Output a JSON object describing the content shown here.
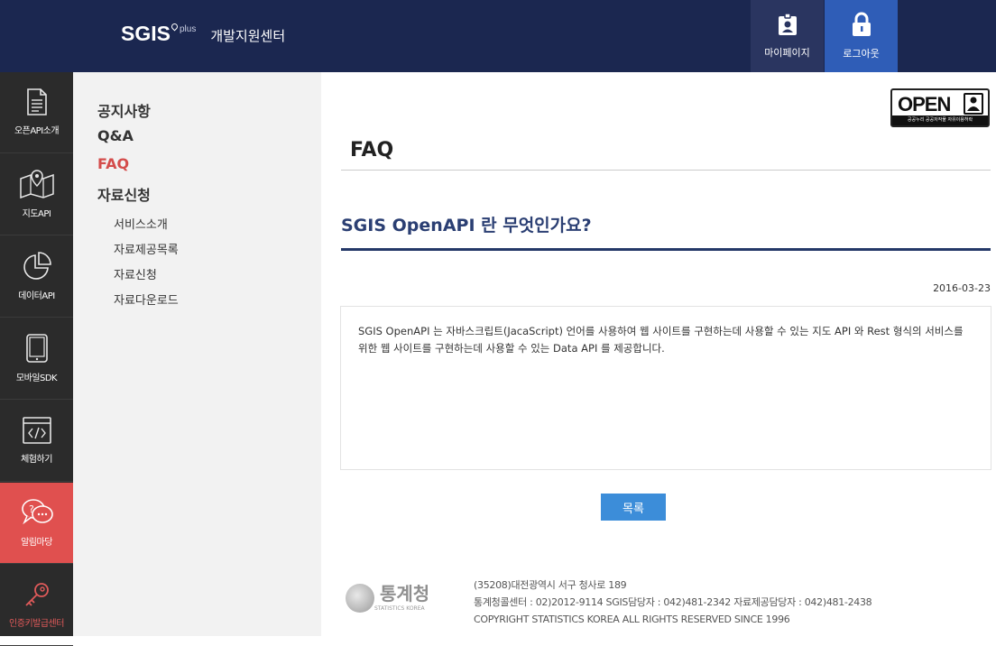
{
  "header": {
    "logo_text": "SGIS",
    "logo_plus": "plus",
    "subtitle": "개발지원센터",
    "mypage_label": "마이페이지",
    "logout_label": "로그아웃"
  },
  "rail": {
    "items": [
      {
        "label": "오픈API소개",
        "icon": "document-icon"
      },
      {
        "label": "지도API",
        "icon": "map-pin-icon"
      },
      {
        "label": "데이터API",
        "icon": "pie-chart-icon"
      },
      {
        "label": "모바일SDK",
        "icon": "tablet-icon"
      },
      {
        "label": "체험하기",
        "icon": "code-window-icon"
      },
      {
        "label": "알림마당",
        "icon": "chat-bubbles-icon"
      },
      {
        "label": "인증키발급센터",
        "icon": "key-icon"
      }
    ]
  },
  "subnav": {
    "main": [
      "공지사항",
      "Q&A",
      "FAQ",
      "자료신청"
    ],
    "sub": [
      "서비스소개",
      "자료제공목록",
      "자료신청",
      "자료다운로드"
    ]
  },
  "content": {
    "badge_text": "OPEN",
    "badge_foot": "공공누리  공공저작물 자유이용허락",
    "page_title": "FAQ",
    "question_title": "SGIS OpenAPI 란 무엇인가요?",
    "date": "2016-03-23",
    "answer": "SGIS OpenAPI 는 자바스크립트(JacaScript) 언어를 사용하여 웹 사이트를 구현하는데 사용할 수 있는 지도 API 와 Rest 형식의 서비스를 위한 웹 사이트를 구현하는데 사용할 수 있는 Data API 를 제공합니다.",
    "list_button": "목록"
  },
  "footer": {
    "org_name": "통계청",
    "org_en": "STATISTICS KOREA",
    "address": "(35208)대전광역시 서구 청사로 189",
    "contacts": "통계청콜센터 : 02)2012-9114 SGIS담당자 : 042)481-2342 자료제공담당자 : 042)481-2438",
    "copyright": "COPYRIGHT STATISTICS KOREA ALL RIGHTS RESERVED SINCE 1996"
  }
}
